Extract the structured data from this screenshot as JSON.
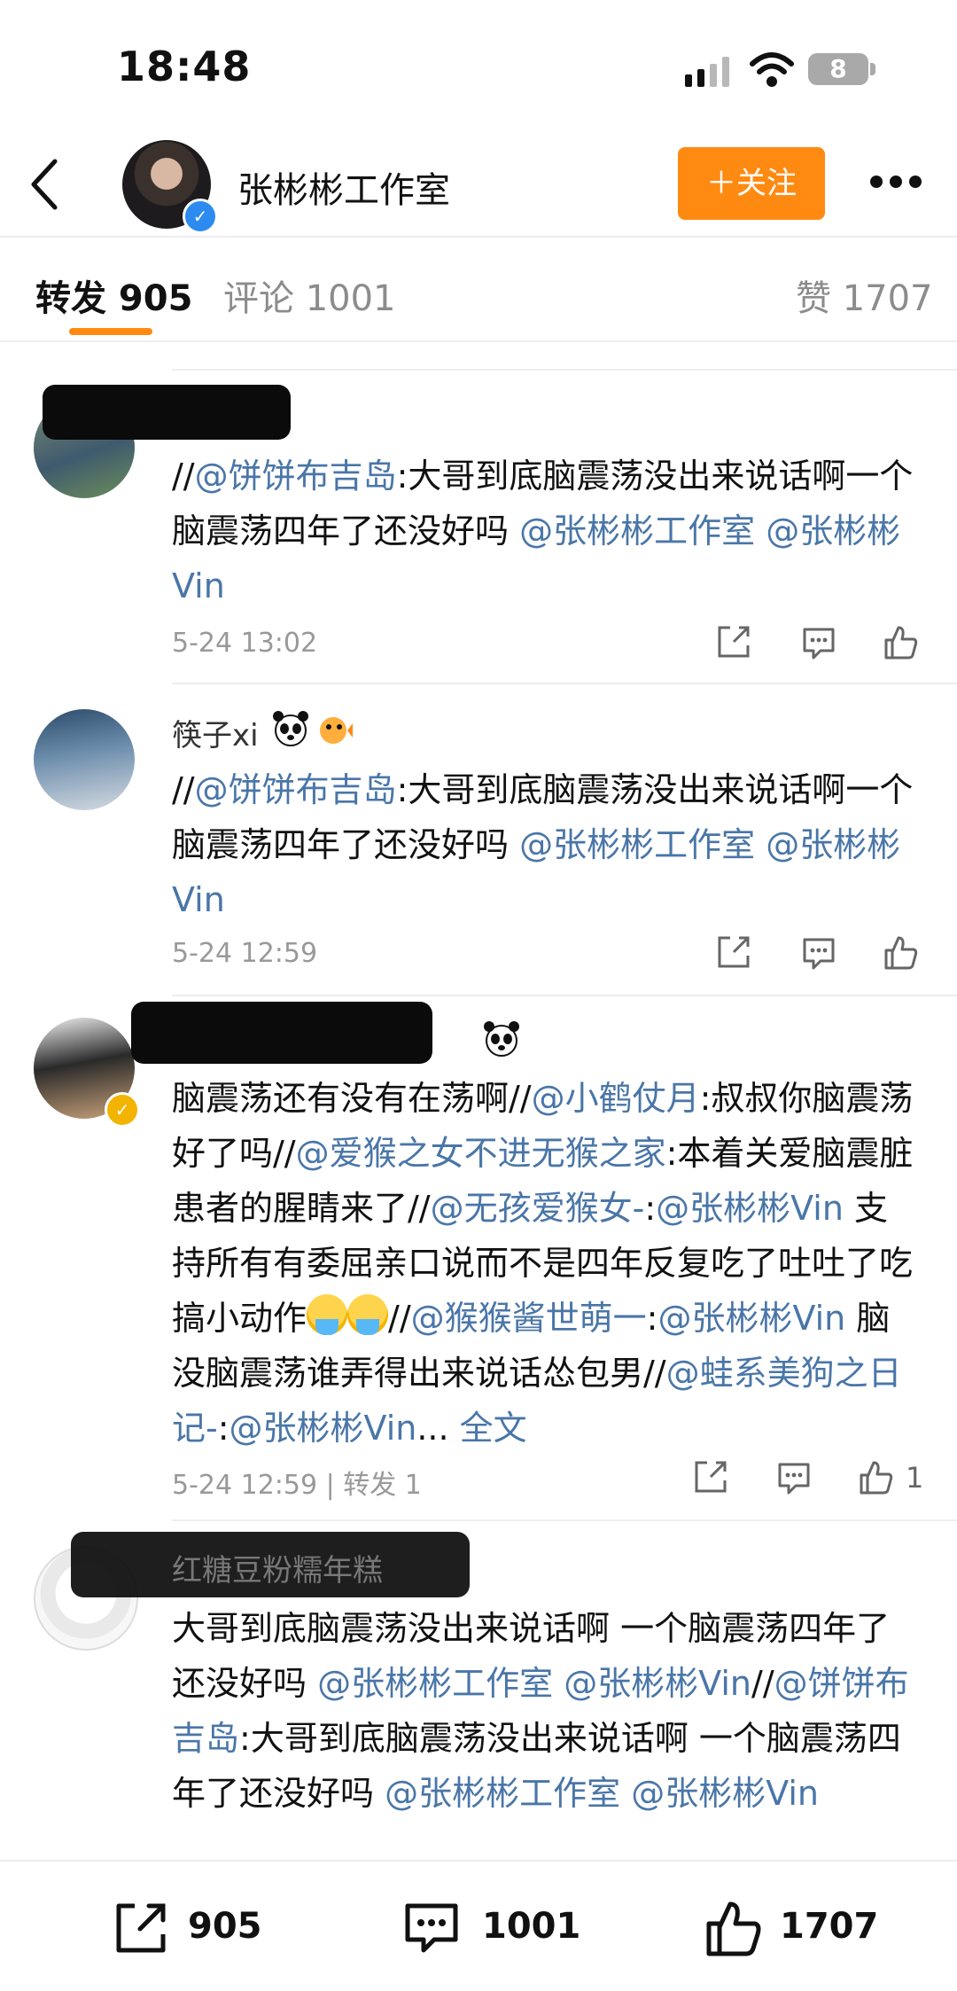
{
  "status": {
    "time": "18:48",
    "battery": "8"
  },
  "header": {
    "title": "张彬彬工作室",
    "follow_label": "＋关注"
  },
  "tabs": {
    "repost": "转发 905",
    "comment": "评论 1001",
    "like": "赞 1707"
  },
  "comments": [
    {
      "name": "",
      "segments": [
        {
          "t": "//",
          "c": "text"
        },
        {
          "t": "@饼饼布吉岛",
          "c": "mention"
        },
        {
          "t": ":大哥到底脑震荡没出来说话啊一个脑震荡四年了还没好吗 ",
          "c": "text"
        },
        {
          "t": "@张彬彬工作室",
          "c": "mention"
        },
        {
          "t": " ",
          "c": "text"
        },
        {
          "t": "@张彬彬Vin",
          "c": "mention"
        }
      ],
      "time": "5-24 13:02"
    },
    {
      "name": "筷子xi",
      "segments": [
        {
          "t": "//",
          "c": "text"
        },
        {
          "t": "@饼饼布吉岛",
          "c": "mention"
        },
        {
          "t": ":大哥到底脑震荡没出来说话啊一个脑震荡四年了还没好吗 ",
          "c": "text"
        },
        {
          "t": "@张彬彬工作室",
          "c": "mention"
        },
        {
          "t": " ",
          "c": "text"
        },
        {
          "t": "@张彬彬Vin",
          "c": "mention"
        }
      ],
      "time": "5-24 12:59"
    },
    {
      "name": "",
      "segments": [
        {
          "t": "脑震荡还有没有在荡啊//",
          "c": "text"
        },
        {
          "t": "@小鹤仗月",
          "c": "mention"
        },
        {
          "t": ":叔叔你脑震荡好了吗//",
          "c": "text"
        },
        {
          "t": "@爱猴之女不进无猴之家",
          "c": "mention"
        },
        {
          "t": ":本着关爱脑震脏患者的腥睛来了//",
          "c": "text"
        },
        {
          "t": "@无孩爱猴女-",
          "c": "mention"
        },
        {
          "t": ":",
          "c": "text"
        },
        {
          "t": "@张彬彬Vin",
          "c": "mention"
        },
        {
          "t": " 支持所有有委屈亲口说而不是四年反复吃了吐吐了吃搞小动作",
          "c": "text"
        },
        {
          "t": "",
          "c": "emoji"
        },
        {
          "t": "",
          "c": "emoji"
        },
        {
          "t": "//",
          "c": "text"
        },
        {
          "t": "@猴猴酱世萌一",
          "c": "mention"
        },
        {
          "t": ":",
          "c": "text"
        },
        {
          "t": "@张彬彬Vin",
          "c": "mention"
        },
        {
          "t": " 脑没脑震荡谁弄得出来说话怂包男//",
          "c": "text"
        },
        {
          "t": "@蛙系美狗之日记-",
          "c": "mention"
        },
        {
          "t": ":",
          "c": "text"
        },
        {
          "t": "@张彬彬Vin",
          "c": "mention"
        },
        {
          "t": "... ",
          "c": "text"
        },
        {
          "t": "全文",
          "c": "mention"
        }
      ],
      "time": "5-24 12:59 | 转发 1",
      "like_count": "1"
    },
    {
      "name": "红糖豆粉糯年糕",
      "segments": [
        {
          "t": "大哥到底脑震荡没出来说话啊 一个脑震荡四年了还没好吗 ",
          "c": "text"
        },
        {
          "t": "@张彬彬工作室",
          "c": "mention"
        },
        {
          "t": " ",
          "c": "text"
        },
        {
          "t": "@张彬彬Vin",
          "c": "mention"
        },
        {
          "t": "//",
          "c": "text"
        },
        {
          "t": "@饼饼布吉岛",
          "c": "mention"
        },
        {
          "t": ":大哥到底脑震荡没出来说话啊 一个脑震荡四年了还没好吗 ",
          "c": "text"
        },
        {
          "t": "@张彬彬工作室",
          "c": "mention"
        },
        {
          "t": " ",
          "c": "text"
        },
        {
          "t": "@张彬彬Vin",
          "c": "mention"
        }
      ],
      "time": ""
    }
  ],
  "bottom": {
    "repost_count": "905",
    "comment_count": "1001",
    "like_count": "1707"
  },
  "colors": {
    "accent": "#ff8a12",
    "mention": "#4a76a8",
    "verify": "#2d8bf0"
  },
  "icons": [
    "back-icon",
    "more-icon",
    "share-icon",
    "comment-icon",
    "like-icon",
    "signal-icon",
    "wifi-icon",
    "battery-icon",
    "verified-icon",
    "panda-icon",
    "crying-emoji"
  ]
}
